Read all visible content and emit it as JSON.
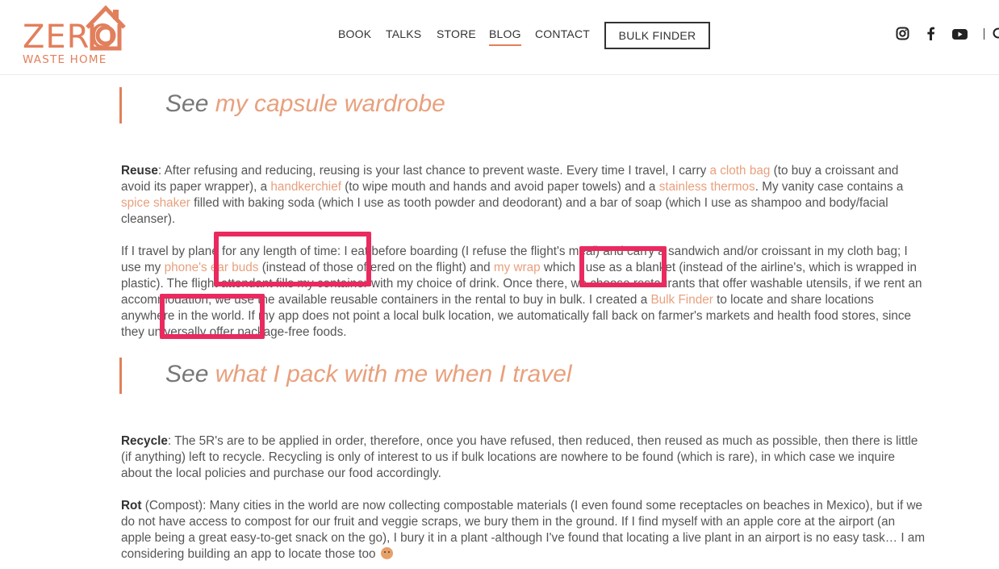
{
  "brand": {
    "logo_main": "ZERO",
    "logo_sub": "WASTE HOME",
    "accent_color": "#e27f5c",
    "link_color": "#e8a07d",
    "highlight_color": "#ea2a5f"
  },
  "nav": {
    "items": [
      "BOOK",
      "TALKS",
      "STORE",
      "BLOG",
      "CONTACT"
    ],
    "active": "BLOG",
    "cta": "BULK FINDER"
  },
  "social": [
    "instagram-icon",
    "facebook-icon",
    "youtube-icon",
    "search-icon"
  ],
  "quotes": [
    {
      "prefix": "See ",
      "link": "my capsule wardrobe"
    },
    {
      "prefix": "See ",
      "link": "what I pack with me when I travel"
    }
  ],
  "reuse": {
    "heading": "Reuse",
    "t1": ": After refusing and reducing, reusing is your last chance to prevent waste. Every time I travel, I carry ",
    "l1": "a cloth bag",
    "t2": " (to buy a croissant and avoid its paper wrapper), a ",
    "l2": "handkerchief",
    "t3": " (to wipe mouth and hands and avoid paper towels) and a ",
    "l3": "stainless thermos",
    "t4": ". My vanity case contains a ",
    "l4": "spice shaker",
    "t5": " filled with baking soda (which I use as tooth powder and deodorant) and a bar of soap (which I use as shampoo and body/facial cleanser)."
  },
  "travel": {
    "t1": "If I travel by plane for any length of time: I eat before boarding (I refuse the flight's meal) and carry a sandwich and/or croissant in my cloth bag; I use my ",
    "l1": "phone's ear buds",
    "t2": " (instead of those offered on the flight) and ",
    "l2": "my wrap",
    "t3": " which I use as a blanket (instead of the airline's, which is wrapped in plastic). The flight attendant fills my container with my choice of drink. Once there, we choose restaurants that offer washable utensils, if we rent an accommodation, we use the available reusable containers in the rental to buy in bulk. I created a ",
    "l3": "Bulk Finder",
    "t4": " to locate and share locations anywhere in the world. If my app does not point a local bulk location, we automatically fall back on farmer's markets and health food stores, since they universally offer package-free foods."
  },
  "recycle": {
    "heading": "Recycle",
    "text": ": The 5R's are to be applied in order, therefore, once you have refused, then reduced, then reused as much as possible, then there is little (if anything) left  to recycle. Recycling is only of interest to us if bulk locations are nowhere to be found (which is rare), in which case we inquire about the local policies and purchase our food accordingly."
  },
  "rot": {
    "heading": "Rot",
    "text": " (Compost): Many cities in the world are now collecting compostable materials (I even found some receptacles on beaches in Mexico), but if we do not have access to compost for our fruit and veggie scraps, we bury them in the ground. If I find myself with an apple core at the airport (an apple being a great easy-to-get snack on the go), I bury it in a plant -although I've found that locating a live plant in an airport is no easy task… I am considering building an app to locate those too "
  }
}
